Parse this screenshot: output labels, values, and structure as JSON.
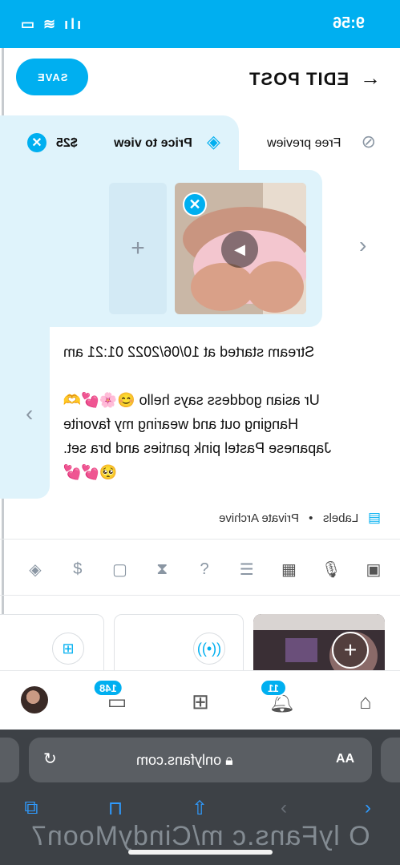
{
  "status_bar": {
    "time": "9:56",
    "icons_label": "●▬ ≋ Ill"
  },
  "header": {
    "title": "EDIT POST",
    "back_icon": "arrow-right-icon",
    "save_label": "SAVE"
  },
  "price": {
    "free_preview_label": "Free preview",
    "price_to_view_label": "Price to view",
    "price_value": "$25"
  },
  "caption": {
    "lines": [
      "Stream started at 10/06/2022 01:21 am",
      "",
      "Ur asian goddess says hello 😊🌸💕🫶",
      "Hanging out and wearing my favorite",
      "Japanese Pastel pink panties and bra set.",
      "🥺💕💕"
    ]
  },
  "labels": {
    "label": "Labels",
    "value": "Private Archive"
  },
  "bottom_nav": {
    "notifications_badge": "11",
    "messages_badge": "148"
  },
  "safari": {
    "url": "onlyfans.com",
    "aa_label": "AA"
  },
  "watermark": "O lyFans.c m/CindyMoon7",
  "colors": {
    "accent": "#00aff0",
    "panel": "#dff3fb",
    "safari_bg": "#3d4146"
  }
}
